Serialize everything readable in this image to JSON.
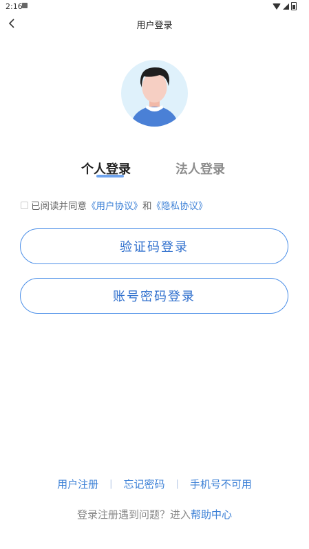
{
  "status_bar": {
    "time": "2:16"
  },
  "nav": {
    "title": "用户登录"
  },
  "tabs": {
    "personal": "个人登录",
    "legal": "法人登录"
  },
  "agreement": {
    "prefix": "已阅读并同意",
    "user_agreement": "《用户协议》",
    "and": "和",
    "privacy_policy": "《隐私协议》"
  },
  "buttons": {
    "sms_login": "验证码登录",
    "password_login": "账号密码登录"
  },
  "bottom_links": {
    "register": "用户注册",
    "forgot_password": "忘记密码",
    "phone_unavailable": "手机号不可用",
    "separator": "|"
  },
  "help": {
    "text": "登录注册遇到问题？进入",
    "link": "帮助中心"
  },
  "colors": {
    "accent": "#3a7fd6",
    "button_border": "#4a8ee8"
  }
}
